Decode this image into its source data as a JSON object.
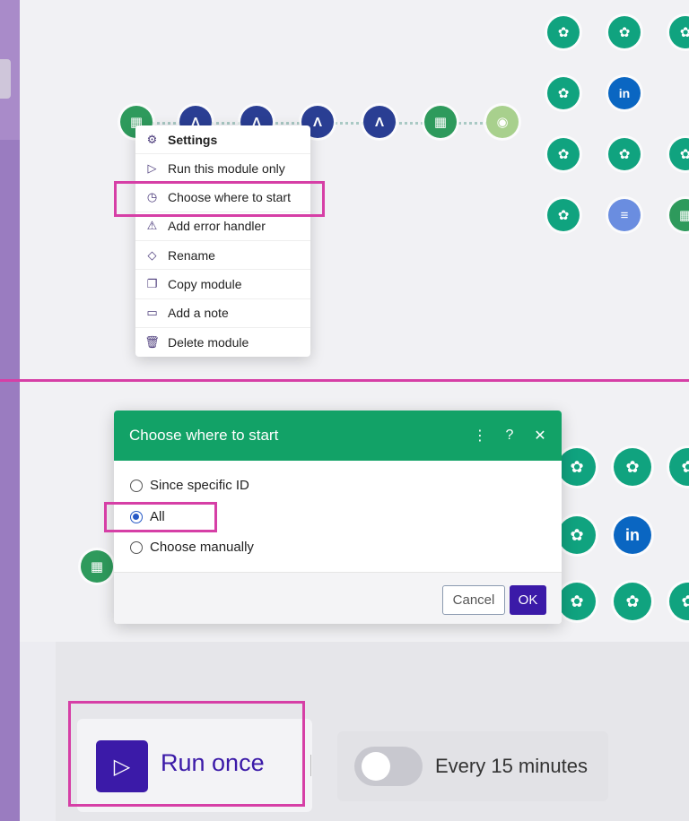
{
  "context_menu": {
    "items": [
      {
        "label": "Settings",
        "icon": "gear-icon"
      },
      {
        "label": "Run this module only",
        "icon": "play-icon"
      },
      {
        "label": "Choose where to start",
        "icon": "clock-icon"
      },
      {
        "label": "Add error handler",
        "icon": "warning-icon"
      },
      {
        "label": "Rename",
        "icon": "eraser-icon"
      },
      {
        "label": "Copy module",
        "icon": "copy-icon"
      },
      {
        "label": "Add a note",
        "icon": "note-icon"
      },
      {
        "label": "Delete module",
        "icon": "trash-icon"
      }
    ]
  },
  "dialog": {
    "title": "Choose where to start",
    "options": [
      "Since specific ID",
      "All",
      "Choose manually"
    ],
    "selected": "All",
    "cancel_label": "Cancel",
    "ok_label": "OK"
  },
  "run_bar": {
    "run_label": "Run once",
    "schedule_label": "Every 15 minutes",
    "schedule_enabled": false
  },
  "colors": {
    "highlight": "#d63fa6",
    "dialog_header": "#12a267",
    "primary": "#3b1aa8"
  }
}
